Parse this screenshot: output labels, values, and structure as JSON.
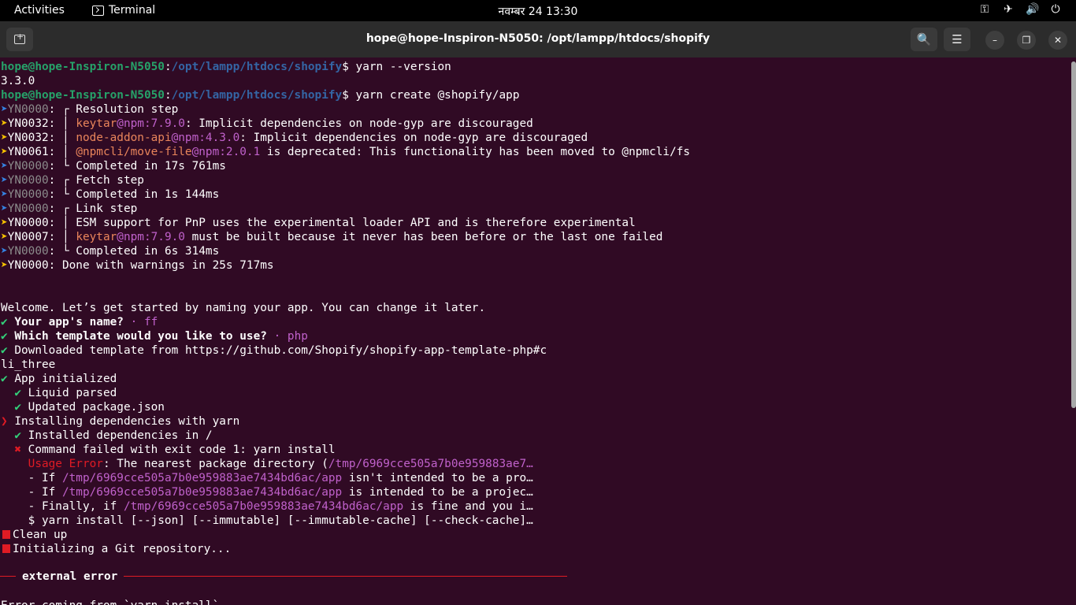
{
  "topbar": {
    "activities": "Activities",
    "app_name": "Terminal",
    "clock": "नवम्बर 24  13:30",
    "tray": {
      "network": "⚿",
      "airplane": "✈",
      "volume": "🔊",
      "power": "⏻"
    }
  },
  "window": {
    "title": "hope@hope-Inspiron-N5050: /opt/lampp/htdocs/shopify",
    "search_glyph": "🔍",
    "menu_glyph": "☰",
    "minimize_glyph": "–",
    "maximize_glyph": "❐",
    "close_glyph": "✕"
  },
  "terminal": {
    "prompt_user": "hope@hope-Inspiron-N5050",
    "prompt_path": "/opt/lampp/htdocs/shopify",
    "cmd1": " yarn --version",
    "out_version": "3.3.0",
    "cmd2": " yarn create @shopify/app",
    "yarn_log": [
      {
        "arrow": "blue",
        "code": "YN0000",
        "text": "┌ Resolution step"
      },
      {
        "arrow": "yellow",
        "code": "YN0032",
        "pkg": "keytar",
        "ver": "@npm:7.9.0",
        "text": ": Implicit dependencies on node-gyp are discouraged"
      },
      {
        "arrow": "yellow",
        "code": "YN0032",
        "pkg": "node-addon-api",
        "ver": "@npm:4.3.0",
        "text": ": Implicit dependencies on node-gyp are discouraged"
      },
      {
        "arrow": "yellow",
        "code": "YN0061",
        "pkg": "@npmcli/move-file",
        "ver": "@npm:2.0.1",
        "text": " is deprecated: This functionality has been moved to @npmcli/fs"
      },
      {
        "arrow": "blue",
        "code": "YN0000",
        "text": "└ Completed in 17s 761ms"
      },
      {
        "arrow": "blue",
        "code": "YN0000",
        "text": "┌ Fetch step"
      },
      {
        "arrow": "blue",
        "code": "YN0000",
        "text": "└ Completed in 1s 144ms"
      },
      {
        "arrow": "blue",
        "code": "YN0000",
        "text": "┌ Link step"
      },
      {
        "arrow": "yellow",
        "code": "YN0000",
        "text": "│ ESM support for PnP uses the experimental loader API and is therefore experimental"
      },
      {
        "arrow": "yellow",
        "code": "YN0007",
        "pkg": "keytar",
        "ver": "@npm:7.9.0",
        "text": " must be built because it never has been before or the last one failed"
      },
      {
        "arrow": "blue",
        "code": "YN0000",
        "text": "└ Completed in 6s 314ms"
      },
      {
        "arrow": "yellow",
        "code": "YN0000",
        "text": "Done with warnings in 25s 717ms"
      }
    ],
    "welcome": "Welcome. Let’s get started by naming your app. You can change it later.",
    "q_name": "Your app's name?",
    "a_name": "ff",
    "q_template": "Which template would you like to use?",
    "a_template": "php",
    "downloaded_1": "Downloaded template from https://github.com/Shopify/shopify-app-template-php#c",
    "downloaded_2": "li_three",
    "app_initialized": "App initialized",
    "liquid_parsed": "Liquid parsed",
    "updated_pkg": "Updated package.json",
    "installing_deps": "Installing dependencies with yarn",
    "installed_deps": "Installed dependencies in /",
    "cmd_failed": "Command failed with exit code 1: yarn install",
    "usage_error_label": "Usage Error",
    "usage_error_text": ": The nearest package directory (",
    "usage_error_path": "/tmp/6969cce505a7b0e959883ae7…",
    "if1_prefix": "- If ",
    "if1_path": "/tmp/6969cce505a7b0e959883ae7434bd6ac/app",
    "if1_suffix": " isn't intended to be a pro…",
    "if2_prefix": "- If ",
    "if2_path": "/tmp/6969cce505a7b0e959883ae7434bd6ac/app",
    "if2_suffix": " is intended to be a projec…",
    "finally_prefix": "- Finally, if ",
    "finally_path": "/tmp/6969cce505a7b0e959883ae7434bd6ac/app",
    "finally_suffix": " is fine and you i…",
    "yarn_usage": "$ yarn install [--json] [--immutable] [--immutable-cache] [--check-cache]…",
    "clean_up": "Clean up",
    "init_git": "Initializing a Git repository...",
    "external_error": "external error",
    "error_coming": "Error coming from `yarn install`"
  }
}
